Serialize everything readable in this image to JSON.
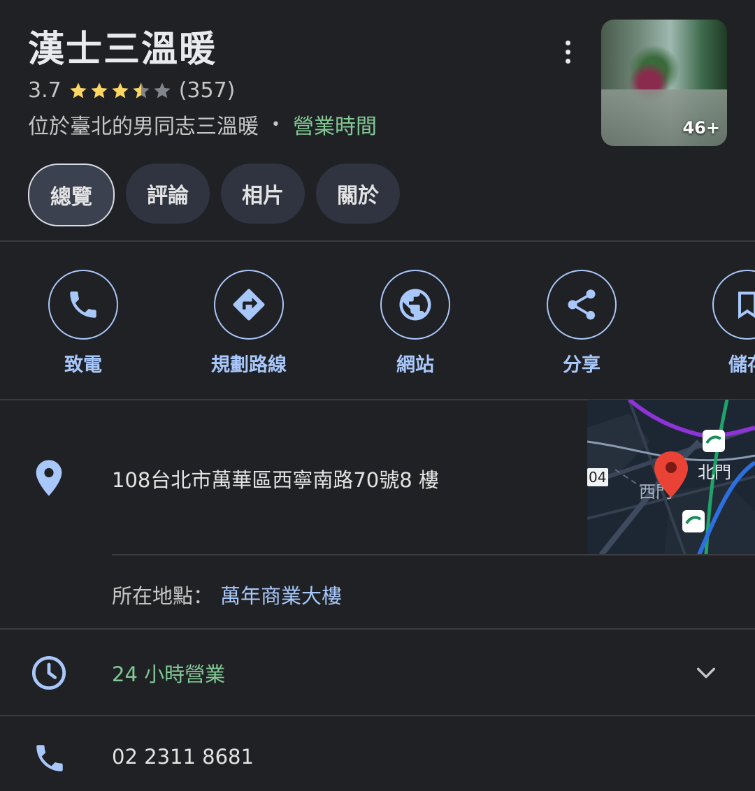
{
  "place": {
    "name": "漢士三溫暖",
    "rating": "3.7",
    "rating_value": 3.7,
    "review_count": "(357)",
    "category": "位於臺北的男同志三溫暖",
    "separator": "•",
    "hours_link": "營業時間",
    "photo_count": "46+"
  },
  "tabs": [
    {
      "label": "總覽",
      "active": true
    },
    {
      "label": "評論",
      "active": false
    },
    {
      "label": "相片",
      "active": false
    },
    {
      "label": "關於",
      "active": false
    }
  ],
  "actions": [
    {
      "label": "致電",
      "icon": "phone-icon"
    },
    {
      "label": "規劃路線",
      "icon": "directions-icon"
    },
    {
      "label": "網站",
      "icon": "globe-icon"
    },
    {
      "label": "分享",
      "icon": "share-icon"
    },
    {
      "label": "儲存",
      "icon": "bookmark-icon"
    }
  ],
  "address": {
    "text": "108台北市萬華區西寧南路70號8 樓",
    "located_in_label": "所在地點：",
    "located_in_value": "萬年商業大樓"
  },
  "map": {
    "labels": [
      "北門",
      "西門",
      "04"
    ]
  },
  "hours": {
    "status": "24 小時營業"
  },
  "phone": {
    "number": "02 2311 8681"
  },
  "colors": {
    "background": "#202124",
    "accent_blue": "#a8c7fa",
    "open_green": "#81c995",
    "star_gold": "#fdd663"
  }
}
